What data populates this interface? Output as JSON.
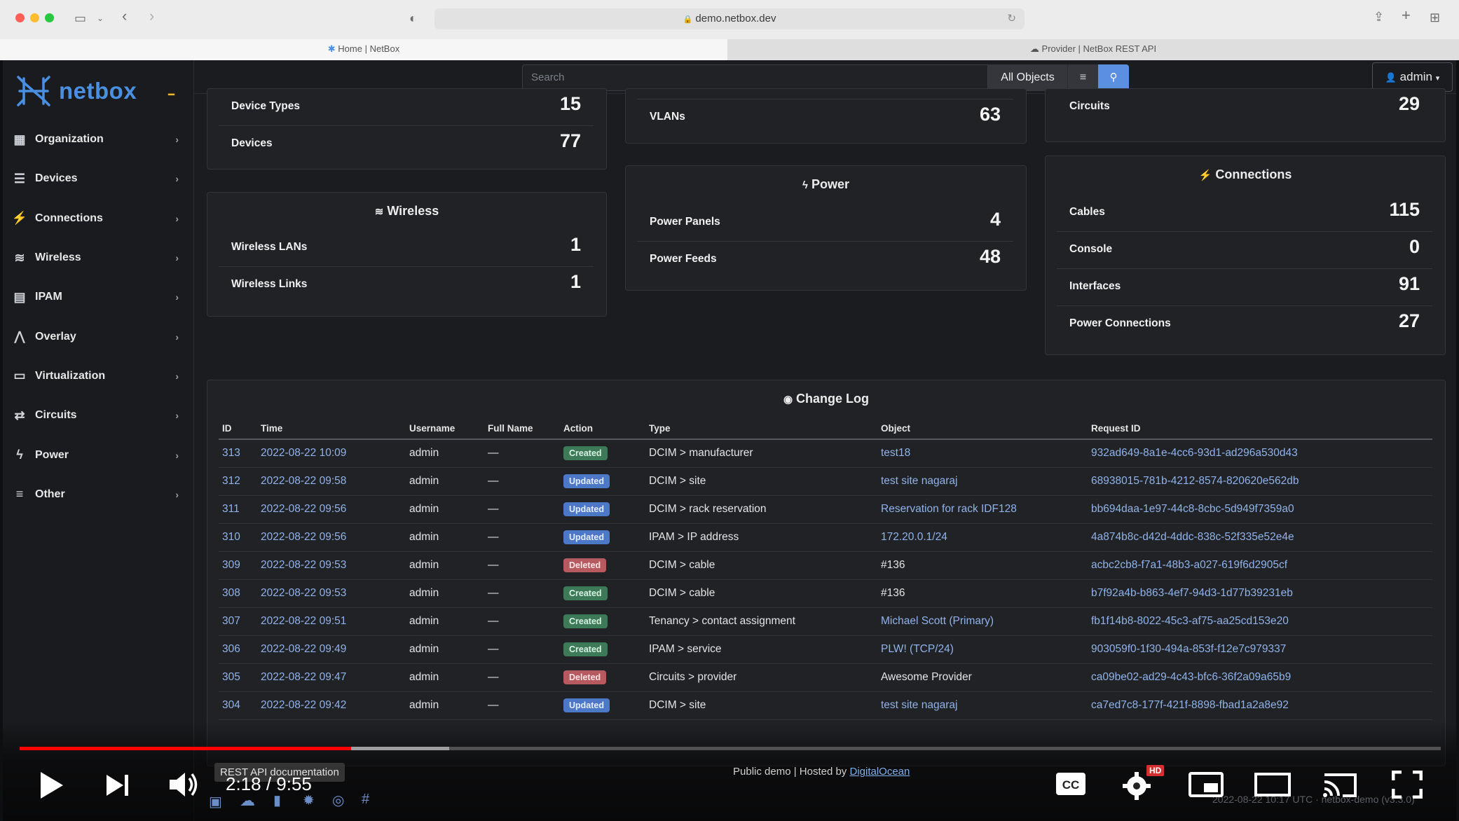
{
  "browser": {
    "url": "demo.netbox.dev",
    "tabs": [
      "Home | NetBox",
      "Provider | NetBox REST API"
    ]
  },
  "sidebar": {
    "brand": "netbox",
    "items": [
      {
        "label": "Organization",
        "icon": "org-icon"
      },
      {
        "label": "Devices",
        "icon": "server-icon"
      },
      {
        "label": "Connections",
        "icon": "plug-icon"
      },
      {
        "label": "Wireless",
        "icon": "wifi-icon"
      },
      {
        "label": "IPAM",
        "icon": "ipam-icon"
      },
      {
        "label": "Overlay",
        "icon": "overlay-icon"
      },
      {
        "label": "Virtualization",
        "icon": "monitor-icon"
      },
      {
        "label": "Circuits",
        "icon": "circuit-icon"
      },
      {
        "label": "Power",
        "icon": "bolt-icon"
      },
      {
        "label": "Other",
        "icon": "menu-icon"
      }
    ]
  },
  "topbar": {
    "search_placeholder": "Search",
    "scope": "All Objects",
    "user": "admin"
  },
  "cards": {
    "devices": {
      "rows": [
        {
          "label": "Device Types",
          "value": "15"
        },
        {
          "label": "Devices",
          "value": "77"
        }
      ]
    },
    "vlans": {
      "rows": [
        {
          "label": "VLANs",
          "value": "63"
        }
      ]
    },
    "circuits": {
      "rows": [
        {
          "label": "Circuits",
          "value": "29"
        }
      ]
    },
    "wireless": {
      "title": "Wireless",
      "rows": [
        {
          "label": "Wireless LANs",
          "value": "1"
        },
        {
          "label": "Wireless Links",
          "value": "1"
        }
      ]
    },
    "power": {
      "title": "Power",
      "rows": [
        {
          "label": "Power Panels",
          "value": "4"
        },
        {
          "label": "Power Feeds",
          "value": "48"
        }
      ]
    },
    "connections": {
      "title": "Connections",
      "rows": [
        {
          "label": "Cables",
          "value": "115"
        },
        {
          "label": "Console",
          "value": "0"
        },
        {
          "label": "Interfaces",
          "value": "91"
        },
        {
          "label": "Power Connections",
          "value": "27"
        }
      ]
    }
  },
  "changelog": {
    "title": "Change Log",
    "columns": [
      "ID",
      "Time",
      "Username",
      "Full Name",
      "Action",
      "Type",
      "Object",
      "Request ID"
    ],
    "rows": [
      {
        "id": "313",
        "time": "2022-08-22 10:09",
        "user": "admin",
        "full": "—",
        "action": "Created",
        "type": "DCIM > manufacturer",
        "object": "test18",
        "object_link": true,
        "req": "932ad649-8a1e-4cc6-93d1-ad296a530d43"
      },
      {
        "id": "312",
        "time": "2022-08-22 09:58",
        "user": "admin",
        "full": "—",
        "action": "Updated",
        "type": "DCIM > site",
        "object": "test site nagaraj",
        "object_link": true,
        "req": "68938015-781b-4212-8574-820620e562db"
      },
      {
        "id": "311",
        "time": "2022-08-22 09:56",
        "user": "admin",
        "full": "—",
        "action": "Updated",
        "type": "DCIM > rack reservation",
        "object": "Reservation for rack IDF128",
        "object_link": true,
        "req": "bb694daa-1e97-44c8-8cbc-5d949f7359a0"
      },
      {
        "id": "310",
        "time": "2022-08-22 09:56",
        "user": "admin",
        "full": "—",
        "action": "Updated",
        "type": "IPAM > IP address",
        "object": "172.20.0.1/24",
        "object_link": true,
        "req": "4a874b8c-d42d-4ddc-838c-52f335e52e4e"
      },
      {
        "id": "309",
        "time": "2022-08-22 09:53",
        "user": "admin",
        "full": "—",
        "action": "Deleted",
        "type": "DCIM > cable",
        "object": "#136",
        "object_link": false,
        "req": "acbc2cb8-f7a1-48b3-a027-619f6d2905cf"
      },
      {
        "id": "308",
        "time": "2022-08-22 09:53",
        "user": "admin",
        "full": "—",
        "action": "Created",
        "type": "DCIM > cable",
        "object": "#136",
        "object_link": false,
        "req": "b7f92a4b-b863-4ef7-94d3-1d77b39231eb"
      },
      {
        "id": "307",
        "time": "2022-08-22 09:51",
        "user": "admin",
        "full": "—",
        "action": "Created",
        "type": "Tenancy > contact assignment",
        "object": "Michael Scott (Primary)",
        "object_link": true,
        "req": "fb1f14b8-8022-45c3-af75-aa25cd153e20"
      },
      {
        "id": "306",
        "time": "2022-08-22 09:49",
        "user": "admin",
        "full": "—",
        "action": "Created",
        "type": "IPAM > service",
        "object": "PLW! (TCP/24)",
        "object_link": true,
        "req": "903059f0-1f30-494a-853f-f12e7c979337"
      },
      {
        "id": "305",
        "time": "2022-08-22 09:47",
        "user": "admin",
        "full": "—",
        "action": "Deleted",
        "type": "Circuits > provider",
        "object": "Awesome Provider",
        "object_link": false,
        "req": "ca09be02-ad29-4c43-bfc6-36f2a09a65b9"
      },
      {
        "id": "304",
        "time": "2022-08-22 09:42",
        "user": "admin",
        "full": "—",
        "action": "Updated",
        "type": "DCIM > site",
        "object": "test site nagaraj",
        "object_link": true,
        "req": "ca7ed7c8-177f-421f-8898-fbad1a2a8e92"
      }
    ]
  },
  "footer": {
    "text": "Public demo | Hosted by ",
    "link": "DigitalOcean",
    "faint": "2022-08-22 10:17 UTC · netbox-demo (v3.3.0)"
  },
  "video": {
    "time": "2:18 / 9:55",
    "progress": 0.233,
    "tooltip": "REST API documentation",
    "hd_badge": "HD"
  },
  "colors": {
    "accent": "#4a90e2",
    "created": "#3d7a58",
    "updated": "#4d78c8",
    "deleted": "#b65a5f",
    "progress": "#ff0000"
  }
}
